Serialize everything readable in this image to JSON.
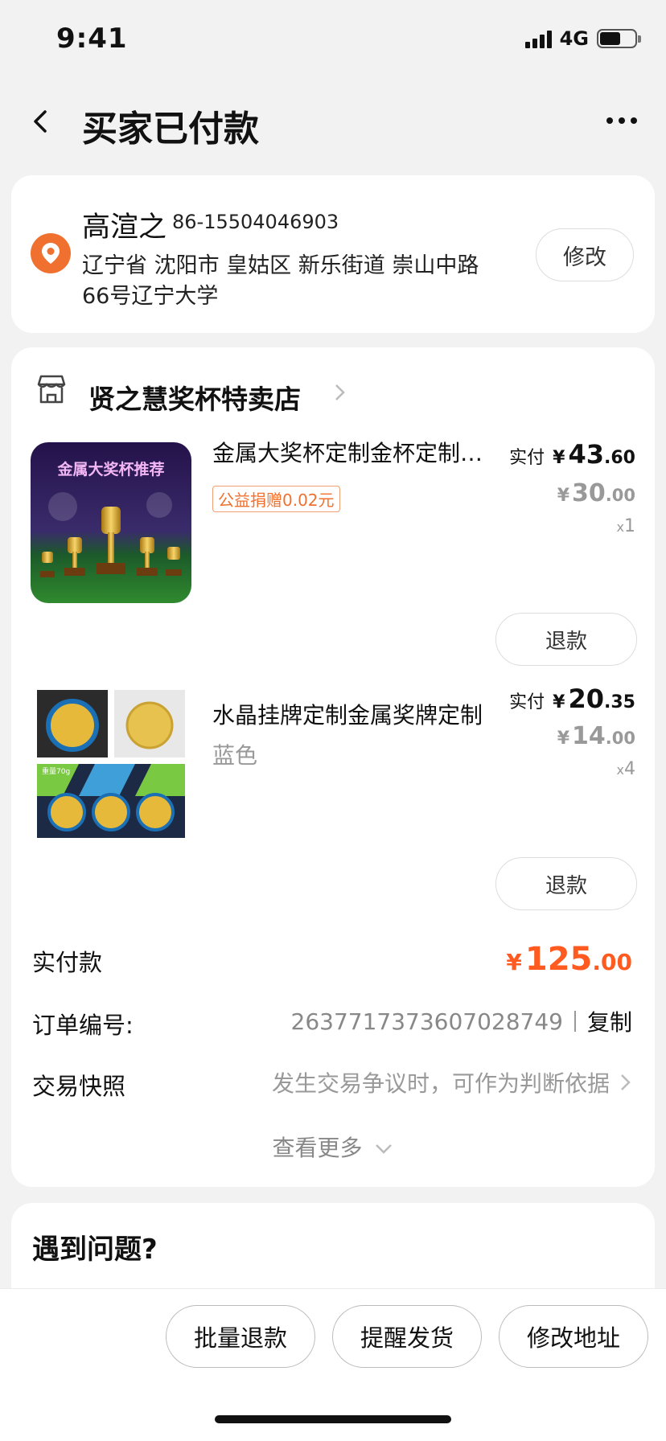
{
  "status": {
    "time": "9:41",
    "network": "4G"
  },
  "nav": {
    "title": "买家已付款"
  },
  "address": {
    "name": "高渲之",
    "phone": "86-15504046903",
    "line1": "辽宁省 沈阳市 皇姑区 新乐街道 崇山中路",
    "line2": "66号辽宁大学",
    "edit_label": "修改"
  },
  "store": {
    "name": "贤之慧奖杯特卖店"
  },
  "items": [
    {
      "title": "金属大奖杯定制金杯定制奖杯",
      "tag": "公益捐赠0.02元",
      "thumb_caption": "金属大奖杯推荐",
      "paid_label": "实付",
      "currency": "¥",
      "paid_int": "43",
      "paid_dec": ".60",
      "orig_int": "30",
      "orig_dec": ".00",
      "qty_x": "x",
      "qty": "1",
      "refund_label": "退款"
    },
    {
      "title": "水晶挂牌定制金属奖牌定制",
      "spec": "蓝色",
      "thumb_caption": "重量70g",
      "paid_label": "实付",
      "currency": "¥",
      "paid_int": "20",
      "paid_dec": ".35",
      "orig_int": "14",
      "orig_dec": ".00",
      "qty_x": "x",
      "qty": "4",
      "refund_label": "退款"
    }
  ],
  "summary": {
    "total_label": "实付款",
    "total_currency": "¥",
    "total_int": "125",
    "total_dec": ".00",
    "order_no_label": "订单编号:",
    "order_no": "2637717373607028749",
    "copy_label": "复制",
    "snapshot_label": "交易快照",
    "snapshot_hint": "发生交易争议时，可作为判断依据",
    "see_more": "查看更多"
  },
  "problem": {
    "title": "遇到问题?"
  },
  "bottom": {
    "batch_refund": "批量退款",
    "remind_ship": "提醒发货",
    "change_address": "修改地址"
  },
  "colors": {
    "accent": "#ff5a1f",
    "location": "#f0712f"
  },
  "icons": [
    "back-icon",
    "more-icon",
    "location-icon",
    "store-icon",
    "chevron-right-icon",
    "chevron-down-icon"
  ]
}
